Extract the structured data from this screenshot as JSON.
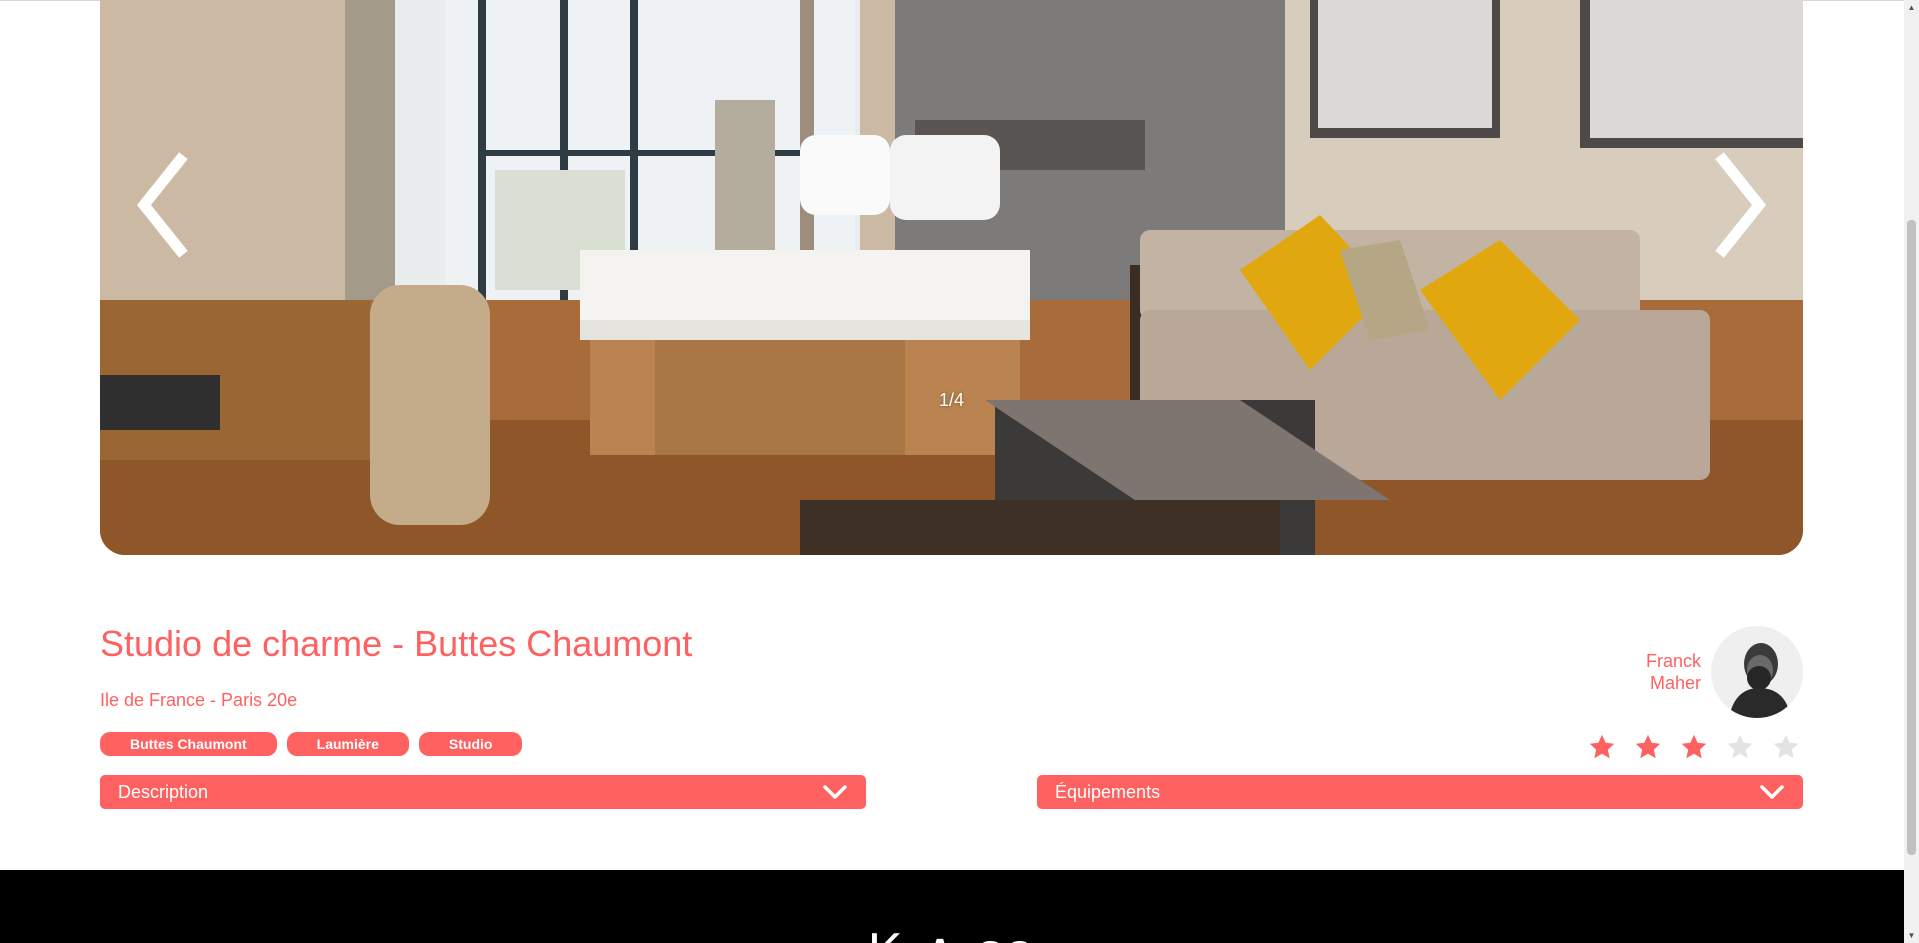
{
  "listing": {
    "title": "Studio de charme - Buttes Chaumont",
    "location": "Ile de France - Paris 20e",
    "tags": [
      "Buttes Chaumont",
      "Laumière",
      "Studio"
    ],
    "rating": 3,
    "rating_max": 5
  },
  "carousel": {
    "counter": "1/4",
    "prev_icon": "chevron-left-icon",
    "next_icon": "chevron-right-icon"
  },
  "host": {
    "first_name": "Franck",
    "last_name": "Maher"
  },
  "collapses": {
    "description_label": "Description",
    "equipment_label": "Équipements"
  },
  "footer": {
    "logo_text": "K ∧ sa"
  },
  "colors": {
    "accent": "#FF6060",
    "star_empty": "#E3E3E3",
    "footer_bg": "#000000"
  }
}
